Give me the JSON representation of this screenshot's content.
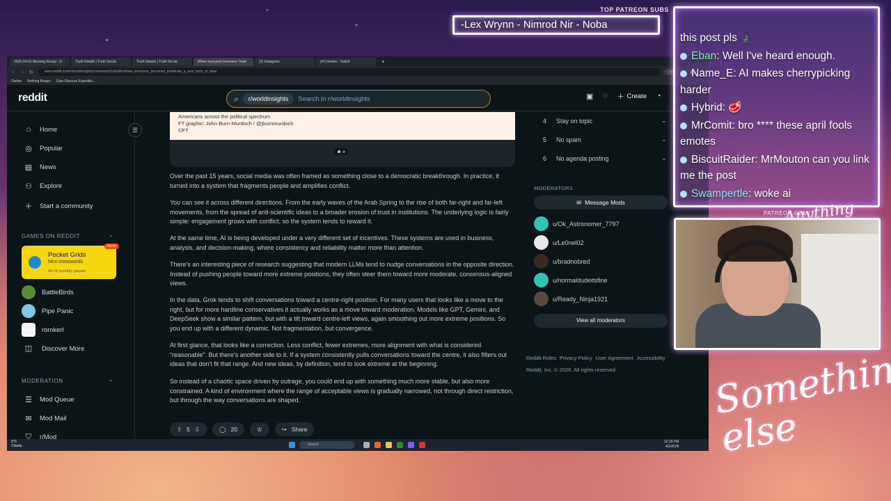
{
  "overlay": {
    "top_subs_label": "TOP PATREON SUBS",
    "top_subs_names": "-Lex Wrynn - Nimrod Nir - Noba",
    "patreon_url": "PATREON.COM/",
    "brand_script_1": "Anything Else",
    "brand_script_2": "Something else"
  },
  "browser": {
    "tabs": [
      {
        "label": "2026-04-01 Morning Recap - G"
      },
      {
        "label": "Truth Details | Truth Social"
      },
      {
        "label": "Truth Details | Truth Social"
      },
      {
        "label": "When everyone becomes \"mod"
      },
      {
        "label": "(3) Instagram"
      },
      {
        "label": "(47) forsen - Twitch"
      }
    ],
    "new_tab": "+",
    "url": "www.reddit.com/r/worldinsights/comments/1s9e89c/when_everyone_becomes_moderate_a_new_form_of_idea/",
    "zoom": "175%",
    "bookmarks": [
      "Dailies",
      "Nothing Burger",
      "Cian Obscure Expeditio..."
    ]
  },
  "header": {
    "logo": "reddit",
    "subreddit_chip": "r/worldinsights",
    "search_placeholder": "Search in r/worldinsights",
    "create_label": "Create"
  },
  "left_nav": {
    "items": [
      {
        "label": "Home",
        "icon": "home-icon"
      },
      {
        "label": "Popular",
        "icon": "popular-icon"
      },
      {
        "label": "News",
        "icon": "news-icon"
      },
      {
        "label": "Explore",
        "icon": "explore-icon"
      },
      {
        "label": "Start a community",
        "icon": "plus-icon"
      }
    ],
    "games_heading": "GAMES ON REDDIT",
    "promo": {
      "title": "Pocket Grids",
      "subtitle": "Mini crosswords",
      "players": "40.7K monthly players",
      "badge": "NEW"
    },
    "games": [
      "BattleBirds",
      "Pipe Panic",
      "romkerl",
      "Discover More"
    ],
    "moderation_heading": "MODERATION",
    "moderation": [
      "Mod Queue",
      "Mod Mail",
      "r/Mod"
    ]
  },
  "post": {
    "image_caption_lines": [
      "Americans across the political spectrum",
      "FT graphic: John Burn-Murdoch / @jburnmurdoch",
      "©FT"
    ],
    "paragraphs": [
      "Over the past 15 years, social media was often framed as something close to a democratic breakthrough. In practice, it turned into a system that fragments people and amplifies conflict.",
      "You can see it across different directions. From the early waves of the Arab Spring to the rise of both far-right and far-left movements, from the spread of anti-scientific ideas to a broader erosion of trust in institutions. The underlying logic is fairly simple: engagement grows with conflict, so the system tends to reward it.",
      "At the same time, AI is being developed under a very different set of incentives. These systems are used in business, analysis, and decision-making, where consistency and reliability matter more than attention.",
      "There's an interesting piece of research suggesting that modern LLMs tend to nudge conversations in the opposite direction. Instead of pushing people toward more extreme positions, they often steer them toward more moderate, consensus-aligned views.",
      "In the data, Grok tends to shift conversations toward a centre-right position. For many users that looks like a move to the right, but for more hardline conservatives it actually works as a move toward moderation. Models like GPT, Gemini, and DeepSeek show a similar pattern, but with a tilt toward centre-left views, again smoothing out more extreme positions. So you end up with a different dynamic. Not fragmentation, but convergence.",
      "At first glance, that looks like a correction. Less conflict, fewer extremes, more alignment with what is considered “reasonable”. But there's another side to it. If a system consistently pulls conversations toward the centre, it also filters out ideas that don't fit that range. And new ideas, by definition, tend to look extreme at the beginning.",
      "So instead of a chaotic space driven by outrage, you could end up with something much more stable, but also more constrained. A kind of environment where the range of acceptable views is gradually narrowed, not through direct restriction, but through the way conversations are shaped."
    ],
    "votes": "5",
    "comments": "20",
    "share_label": "Share"
  },
  "right_sidebar": {
    "rules": [
      {
        "num": "4",
        "label": "Stay on topic"
      },
      {
        "num": "5",
        "label": "No spam"
      },
      {
        "num": "6",
        "label": "No agenda posting"
      }
    ],
    "moderators_heading": "MODERATORS",
    "message_mods_label": "Message Mods",
    "moderators": [
      {
        "name": "u/Ok_Astronomer_7797",
        "color": "#2ec4b6"
      },
      {
        "name": "u/Le0nel02",
        "color": "#e8e8e8"
      },
      {
        "name": "u/bradnobred",
        "color": "#3b2a22"
      },
      {
        "name": "u/normaldudeitsfine",
        "color": "#2ec4b6"
      },
      {
        "name": "u/Ready_Ninja1921",
        "color": "#5a4a40"
      }
    ],
    "view_all_label": "View all moderators",
    "footer_links": [
      "Reddit Rules",
      "Privacy Policy",
      "User Agreement",
      "Accessibility"
    ],
    "copyright": "Reddit, Inc. © 2026. All rights reserved."
  },
  "taskbar": {
    "weather_temp": "9°C",
    "weather_desc": "Cloudy",
    "search_label": "Search",
    "time": "12:15 PM",
    "date": "4/1/2026"
  },
  "chat": {
    "messages": [
      {
        "user": "",
        "text": "this post pls 🧎🏿‍♂️"
      },
      {
        "user": "Eban",
        "user_color": "#7ef0ae",
        "text": "Well I've heard enough."
      },
      {
        "user": "Name_E",
        "user_color": "#ffffff",
        "text": "AI makes cherrypicking harder"
      },
      {
        "user": "Hybrid",
        "user_color": "#ffffff",
        "text": "🥩"
      },
      {
        "user": "MrComit",
        "user_color": "#ffffff",
        "text": "bro **** these april fools emotes"
      },
      {
        "user": "BiscuitRaider",
        "user_color": "#ffffff",
        "text": "MrMouton can you link me the post"
      },
      {
        "user": "Swampertle",
        "user_color": "#8fe3ff",
        "text": "woke ai"
      }
    ]
  }
}
